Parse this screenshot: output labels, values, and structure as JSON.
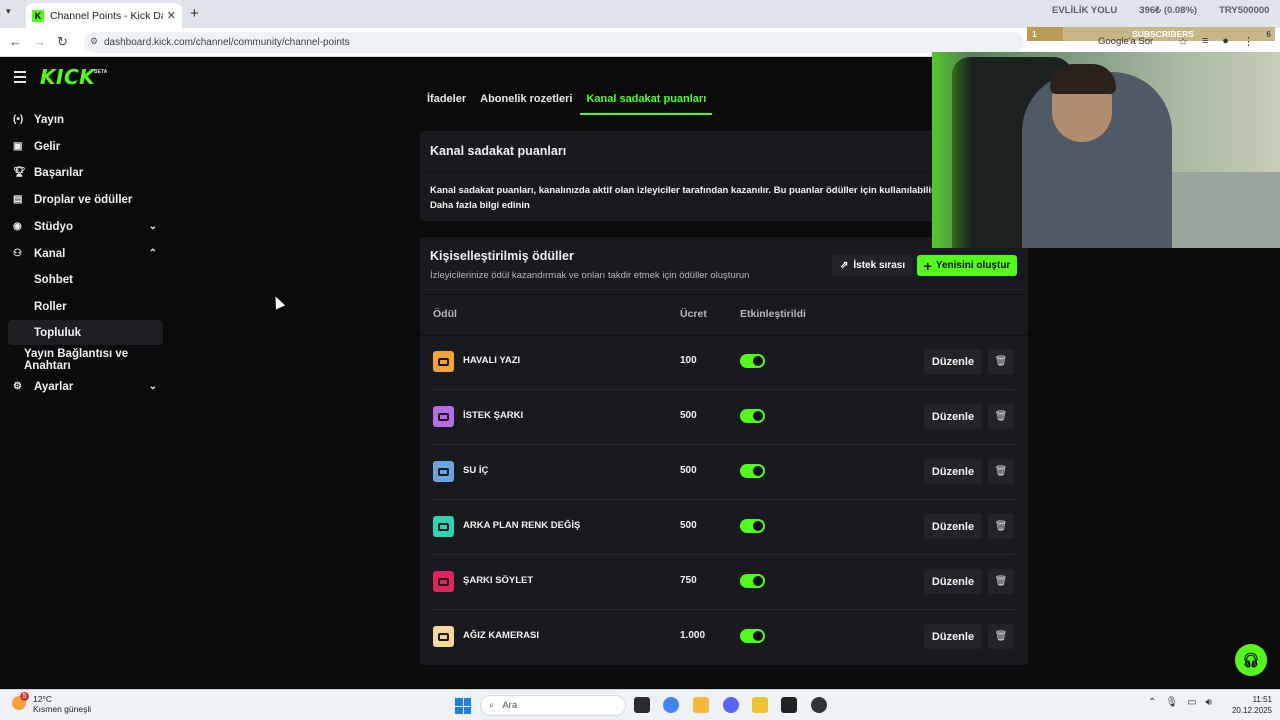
{
  "browser": {
    "tab_title": "Channel Points - Kick Dashboard",
    "url": "dashboard.kick.com/channel/community/channel-points",
    "ticker": [
      "EVLİLİK YOLU",
      "396₺ (0.08%)",
      "TRY500000"
    ],
    "subscribers_overlay": {
      "count": "1",
      "label": "SUBSCRIBERS",
      "goal": "6"
    },
    "google_label": "Google'a Sor"
  },
  "sidebar": {
    "logo": "KICK",
    "logo_badge": "BETA",
    "items": [
      {
        "label": "Yayın",
        "icon": "broadcast-icon"
      },
      {
        "label": "Gelir",
        "icon": "revenue-icon"
      },
      {
        "label": "Başarılar",
        "icon": "trophy-icon"
      },
      {
        "label": "Droplar ve ödüller",
        "icon": "gift-icon"
      },
      {
        "label": "Stüdyo",
        "icon": "studio-icon"
      },
      {
        "label": "Kanal",
        "icon": "channel-icon"
      },
      {
        "label": "Sohbet"
      },
      {
        "label": "Roller"
      },
      {
        "label": "Topluluk"
      },
      {
        "label": "Yayın Bağlantısı ve Anahtarı"
      },
      {
        "label": "Ayarlar",
        "icon": "gear-icon"
      }
    ]
  },
  "tabs": [
    "İfadeler",
    "Abonelik rozetleri",
    "Kanal sadakat puanları"
  ],
  "info_card": {
    "title": "Kanal sadakat puanları",
    "body": "Kanal sadakat puanları, kanalınızda aktif olan izleyiciler tarafından kazanılır. Bu puanlar ödüller için kullanılabilir.",
    "link": "Daha fazla bilgi edinin"
  },
  "rewards_card": {
    "title": "Kişiselleştirilmiş ödüller",
    "subtitle": "İzleyicilerinize ödül kazandırmak ve onları takdir etmek için ödüller oluşturun",
    "queue_button": "İstek sırası",
    "create_button": "Yenisini oluştur",
    "columns": {
      "reward": "Ödül",
      "cost": "Ücret",
      "enabled": "Etkinleştirildi"
    },
    "edit_label": "Düzenle",
    "rows": [
      {
        "name": "HAVALI YAZI",
        "cost": "100",
        "color": "#f2a33a",
        "enabled": true
      },
      {
        "name": "İSTEK ŞARKI",
        "cost": "500",
        "color": "#b86be8",
        "enabled": true
      },
      {
        "name": "SU İÇ",
        "cost": "500",
        "color": "#6aa3e6",
        "enabled": true
      },
      {
        "name": "ARKA PLAN RENK DEĞİŞ",
        "cost": "500",
        "color": "#2fd3b2",
        "enabled": true
      },
      {
        "name": "ŞARKI SÖYLET",
        "cost": "750",
        "color": "#e0245e",
        "enabled": true
      },
      {
        "name": "AĞIZ KAMERASI",
        "cost": "1.000",
        "color": "#f5d79b",
        "enabled": true
      }
    ]
  },
  "taskbar": {
    "weather_temp": "12°C",
    "weather_desc": "Kısmen güneşli",
    "weather_badge": "5",
    "search_placeholder": "Ara",
    "time": "11:51",
    "date": "20.12.2025"
  },
  "colors": {
    "accent": "#53fc18",
    "card": "#191a1d",
    "background": "#0b0b0b"
  }
}
